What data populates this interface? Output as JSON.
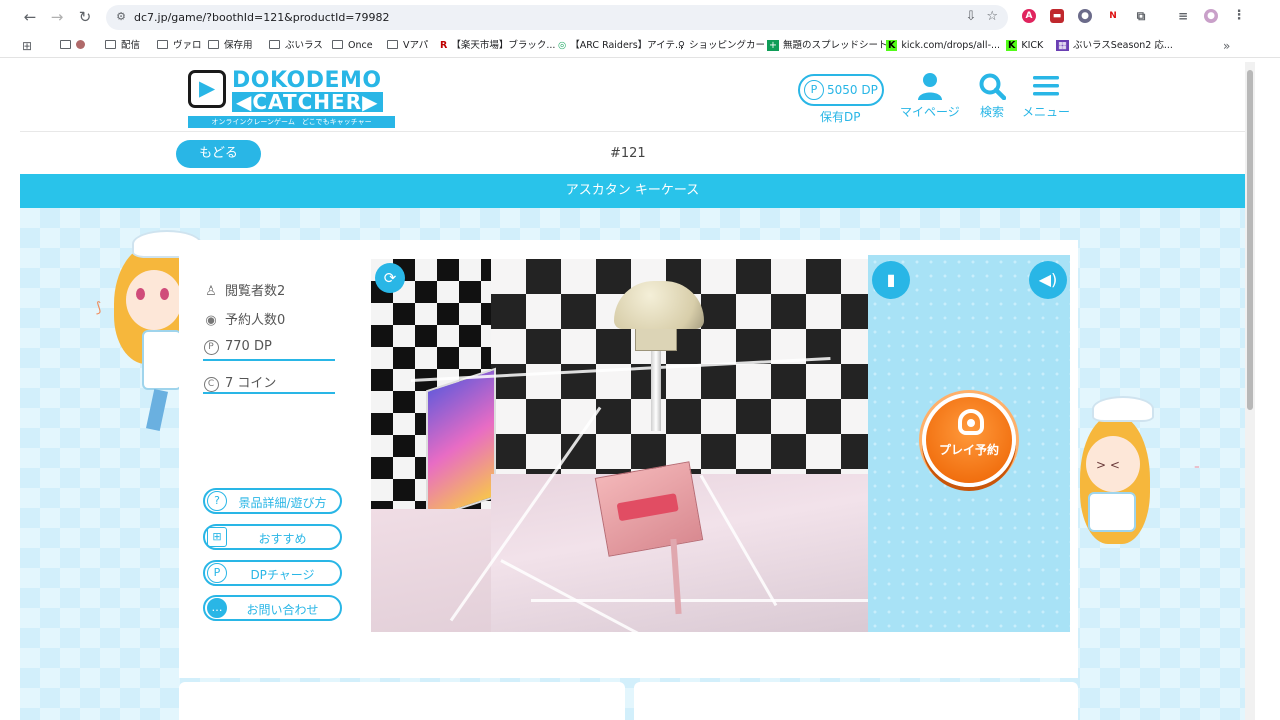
{
  "browser": {
    "url": "dc7.jp/game/?boothId=121&productId=79982",
    "bookmarks": [
      {
        "label": ""
      },
      {
        "label": "配信"
      },
      {
        "label": "ヴァロ"
      },
      {
        "label": "保存用"
      },
      {
        "label": "ぶいラス"
      },
      {
        "label": "Once"
      },
      {
        "label": "Vアパ"
      },
      {
        "label": "【楽天市場】ブラック..."
      },
      {
        "label": "【ARC Raiders】アイテ..."
      },
      {
        "label": "ショッピングカート"
      },
      {
        "label": "無題のスプレッドシート..."
      },
      {
        "label": "kick.com/drops/all-..."
      },
      {
        "label": "KICK"
      },
      {
        "label": "ぶいラスSeason2 応..."
      }
    ],
    "more": "»"
  },
  "header": {
    "logo_top": "DOKODEMO",
    "logo_bottom": "◀CATCHER▶",
    "logo_sub": "オンラインクレーンゲーム　どこでもキャッチャー",
    "dp_balance": "5050 DP",
    "dp_label": "保有DP",
    "mypage": "マイページ",
    "search": "検索",
    "menu": "メニュー"
  },
  "subbar": {
    "back": "もどる",
    "booth": "#121"
  },
  "title": "アスカタン キーケース",
  "stats": {
    "viewers": "閲覧者数2",
    "reservations": "予約人数0",
    "cost_dp": "770 DP",
    "cost_coin": "7 コイン"
  },
  "side_buttons": {
    "details": "景品詳細/遊び方",
    "recommend": "おすすめ",
    "dp_charge": "DPチャージ",
    "contact": "お問い合わせ"
  },
  "controls": {
    "play_reserve": "プレイ予約"
  },
  "colors": {
    "accent": "#29b6e6",
    "play": "#f06c0c",
    "panel": "#a8e2f6"
  }
}
